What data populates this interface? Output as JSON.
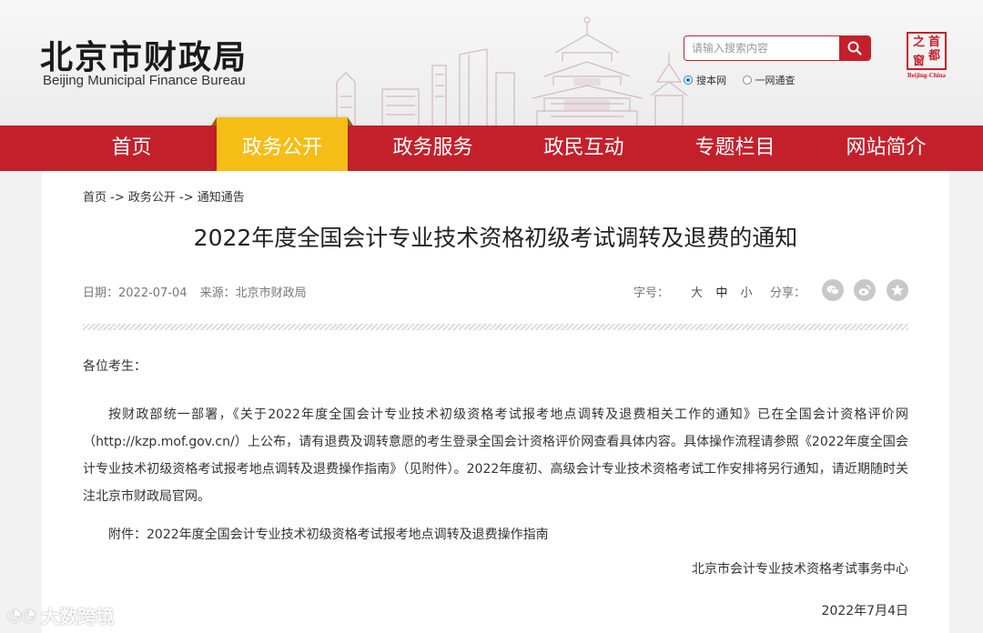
{
  "header": {
    "logo_cn": "北京市财政局",
    "logo_en": "Beijing Municipal Finance Bureau",
    "search": {
      "placeholder": "请输入搜索内容",
      "options": [
        {
          "label": "搜本网",
          "checked": true
        },
        {
          "label": "一网通查",
          "checked": false
        }
      ]
    },
    "seal": {
      "chars": [
        "首",
        "都",
        "之",
        "窗"
      ],
      "caption": "Beijing-China"
    }
  },
  "nav": {
    "items": [
      {
        "label": "首页",
        "active": false
      },
      {
        "label": "政务公开",
        "active": true
      },
      {
        "label": "政务服务",
        "active": false
      },
      {
        "label": "政民互动",
        "active": false
      },
      {
        "label": "专题栏目",
        "active": false
      },
      {
        "label": "网站简介",
        "active": false
      }
    ]
  },
  "breadcrumb": [
    "首页",
    " -> ",
    "政务公开",
    " -> ",
    "通知通告"
  ],
  "article": {
    "title": "2022年度全国会计专业技术资格初级考试调转及退费的通知",
    "date_label": "日期：",
    "date": "2022-07-04",
    "source_label": "来源：",
    "source": "北京市财政局",
    "font_label": "字号：",
    "font_sizes": [
      "大",
      "中",
      "小"
    ],
    "share_label": "分享：",
    "greeting": "各位考生：",
    "paragraph": "按财政部统一部署，《关于2022年度全国会计专业技术初级资格考试报考地点调转及退费相关工作的通知》已在全国会计资格评价网（http://kzp.mof.gov.cn/）上公布，请有退费及调转意愿的考生登录全国会计资格评价网查看具体内容。具体操作流程请参照《2022年度全国会计专业技术初级资格考试报考地点调转及退费操作指南》（见附件）。2022年度初、高级会计专业技术资格考试工作安排将另行通知，请近期随时关注北京市财政局官网。",
    "attachment": "附件：2022年度全国会计专业技术初级资格考试报考地点调转及退费操作指南",
    "signature": "北京市会计专业技术资格考试事务中心",
    "sign_date": "2022年7月4日"
  },
  "watermark": "大数跨境",
  "colors": {
    "brand_red": "#c4202b",
    "active_nav": "#f6bd16"
  }
}
